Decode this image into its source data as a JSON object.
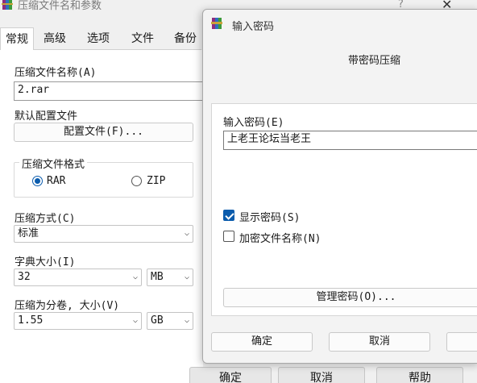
{
  "back": {
    "title": "压缩文件名和参数",
    "help_glyph": "?",
    "close_glyph": "✕",
    "tabs": [
      "常规",
      "高级",
      "选项",
      "文件",
      "备份"
    ],
    "archive_name_label": "压缩文件名称(A)",
    "archive_name_value": "2.rar",
    "default_profile_label": "默认配置文件",
    "profile_button": "配置文件(F)...",
    "format_group_label": "压缩文件格式",
    "format_rar": "RAR",
    "format_zip": "ZIP",
    "method_label": "压缩方式(C)",
    "method_value": "标准",
    "dict_label": "字典大小(I)",
    "dict_value": "32",
    "dict_unit": "MB",
    "split_label": "压缩为分卷, 大小(V)",
    "split_value": "1.55",
    "split_unit": "GB",
    "ok_button": "确定",
    "cancel_button": "取消",
    "help_button": "帮助"
  },
  "dialog": {
    "title": "输入密码",
    "heading": "带密码压缩",
    "password_label": "输入密码(E)",
    "password_value": "上老王论坛当老王",
    "show_password_label": "显示密码(S)",
    "show_password_checked": true,
    "encrypt_names_label": "加密文件名称(N)",
    "encrypt_names_checked": false,
    "manage_button": "管理密码(O)...",
    "ok_button": "确定",
    "cancel_button": "取消"
  },
  "colors": {
    "accent": "#0b5cad",
    "window_bg": "#f0f0f0"
  }
}
